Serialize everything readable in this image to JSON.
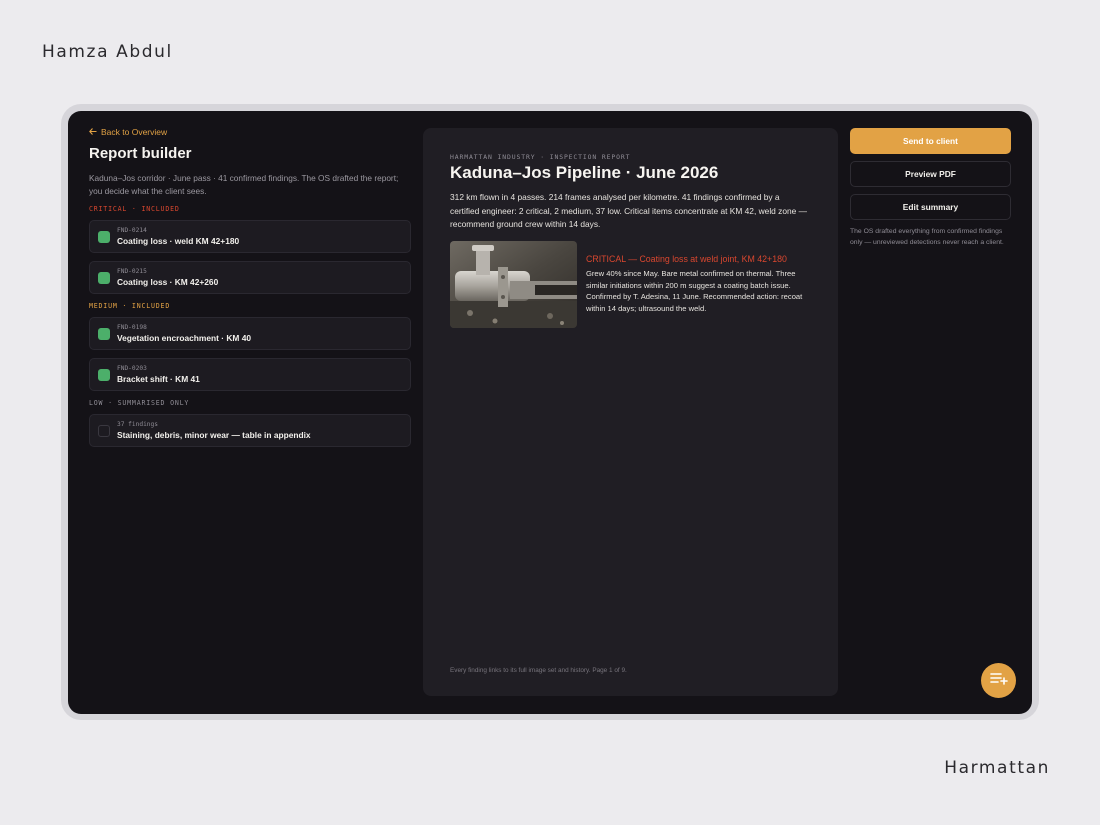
{
  "author": "Hamza Abdul",
  "brand": "Harmattan",
  "left": {
    "back_label": "Back to Overview",
    "title": "Report builder",
    "description": "Kaduna–Jos corridor · June pass · 41 confirmed findings. The OS drafted the report; you decide what the client sees.",
    "sections": [
      {
        "label": "CRITICAL · INCLUDED",
        "items": [
          {
            "id": "FND-0214",
            "title": "Coating loss · weld KM 42+180",
            "checked": true
          },
          {
            "id": "FND-0215",
            "title": "Coating loss · KM 42+260",
            "checked": true
          }
        ]
      },
      {
        "label": "MEDIUM · INCLUDED",
        "items": [
          {
            "id": "FND-0198",
            "title": "Vegetation encroachment · KM 40",
            "checked": true
          },
          {
            "id": "FND-0203",
            "title": "Bracket shift · KM 41",
            "checked": true
          }
        ]
      },
      {
        "label": "LOW · SUMMARISED ONLY",
        "items": [
          {
            "id": "37 findings",
            "title": "Staining, debris, minor wear — table in appendix",
            "checked": false
          }
        ]
      }
    ]
  },
  "doc": {
    "eyebrow": "HARMATTAN INDUSTRY · INSPECTION REPORT",
    "title": "Kaduna–Jos Pipeline · June 2026",
    "summary": "312 km flown in 4 passes. 214 frames analysed per kilometre. 41 findings confirmed by a certified engineer: 2 critical, 2 medium, 37 low. Critical items concentrate at KM 42, weld zone — recommend ground crew within 14 days.",
    "finding_title": "CRITICAL — Coating loss at weld joint, KM 42+180",
    "finding_body": "Grew 40% since May. Bare metal confirmed on thermal. Three similar initiations within 200 m suggest a coating batch issue. Confirmed by T. Adesina, 11 June. Recommended action: recoat within 14 days; ultrasound the weld.",
    "footer": "Every finding links to its full image set and history. Page 1 of 9."
  },
  "right": {
    "send_label": "Send to client",
    "preview_label": "Preview PDF",
    "edit_label": "Edit summary",
    "note": "The OS drafted everything from confirmed findings only — unreviewed detections never reach a client."
  },
  "colors": {
    "accent": "#e2a245",
    "critical": "#d9472f",
    "included_check": "#4caf6a",
    "screen_bg": "#141217"
  },
  "icons": {
    "back": "arrow-left-icon",
    "fab": "list-add-icon"
  }
}
